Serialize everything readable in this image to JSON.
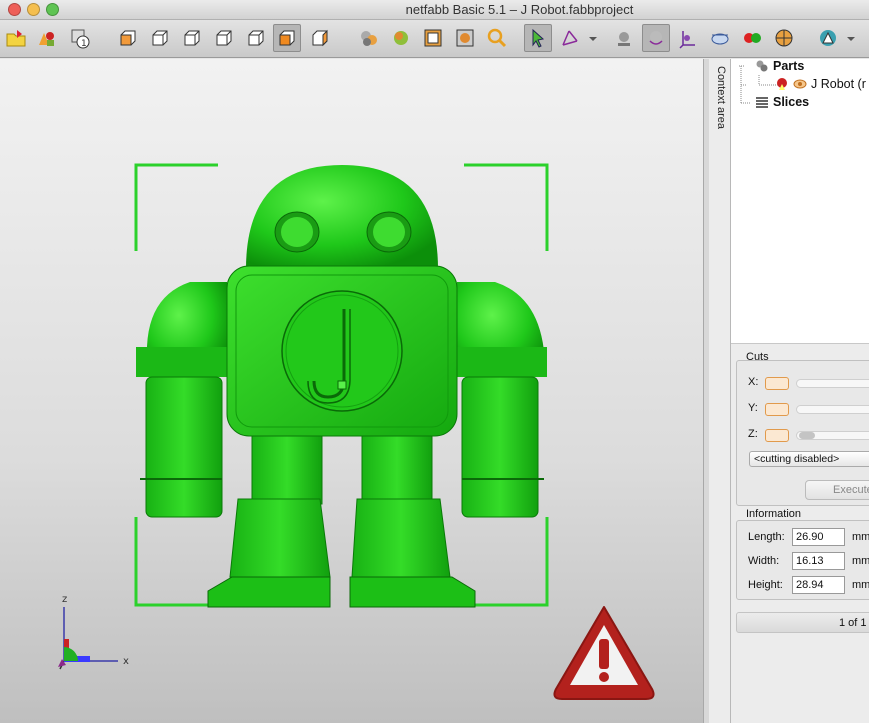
{
  "window": {
    "title": "netfabb Basic 5.1 – J Robot.fabbproject"
  },
  "toolbar": {
    "buttons": [
      {
        "name": "open-project-icon"
      },
      {
        "name": "add-part-icon"
      },
      {
        "name": "part-info-icon"
      },
      {
        "name": "view-front-icon"
      },
      {
        "name": "view-back-icon"
      },
      {
        "name": "view-left-icon"
      },
      {
        "name": "view-right-icon"
      },
      {
        "name": "view-top-icon"
      },
      {
        "name": "view-bottom-icon"
      },
      {
        "name": "view-perspective-icon"
      },
      {
        "name": "show-parts-icon"
      },
      {
        "name": "show-platform-icon"
      },
      {
        "name": "select-all-icon"
      },
      {
        "name": "fit-view-icon"
      },
      {
        "name": "zoom-icon"
      },
      {
        "name": "select-tool-icon"
      },
      {
        "name": "measure-tool-icon"
      },
      {
        "name": "shade-icon"
      },
      {
        "name": "rotate-view-icon"
      },
      {
        "name": "axes-icon"
      },
      {
        "name": "cut-icon"
      },
      {
        "name": "repair-icon"
      },
      {
        "name": "color-icon"
      },
      {
        "name": "analysis-icon"
      }
    ]
  },
  "viewport": {
    "axis_labels": {
      "z": "z",
      "x": "x"
    },
    "part_color": "#22c81a",
    "selection_color": "#2bd12b",
    "warning_color": "#b3211d"
  },
  "context_area": {
    "tab_label": "Context area"
  },
  "tree": {
    "parts_label": "Parts",
    "part_name": "J Robot (r",
    "slices_label": "Slices"
  },
  "cuts": {
    "title": "Cuts",
    "x_label": "X:",
    "y_label": "Y:",
    "z_label": "Z:",
    "mode": "<cutting disabled>",
    "execute_label": "Execute"
  },
  "information": {
    "title": "Information",
    "length_label": "Length:",
    "length_value": "26.90",
    "width_label": "Width:",
    "width_value": "16.13",
    "height_label": "Height:",
    "height_value": "28.94",
    "unit": "mm"
  },
  "pager": {
    "text": "1 of 1"
  }
}
